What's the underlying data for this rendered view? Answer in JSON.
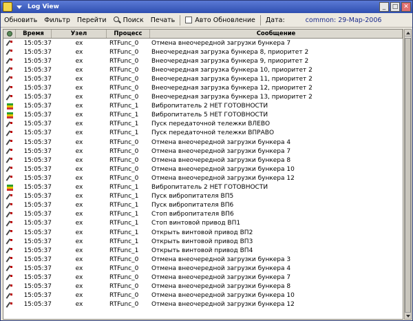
{
  "window": {
    "title": "Log View"
  },
  "toolbar": {
    "refresh": "Обновить",
    "filter": "Фильтр",
    "goto": "Перейти",
    "search": "Поиск",
    "print": "Печать",
    "auto_refresh": "Авто Обновление",
    "date_label": "Дата:",
    "date_value": "common: 29-Мар-2006"
  },
  "columns": {
    "time": "Время",
    "node": "Узел",
    "process": "Процесс",
    "message": "Сообщение"
  },
  "rows": [
    {
      "icon": "pen-icon",
      "time": "15:05:37",
      "node": "ex",
      "process": "RTFunc_0",
      "message": "Отмена внеочередной загрузки бункера 7"
    },
    {
      "icon": "pen-icon",
      "time": "15:05:37",
      "node": "ex",
      "process": "RTFunc_0",
      "message": "Внеочередная загрузка бункера 8, приоритет 2"
    },
    {
      "icon": "pen-icon",
      "time": "15:05:37",
      "node": "ex",
      "process": "RTFunc_0",
      "message": "Внеочередная загрузка бункера 9, приоритет 2"
    },
    {
      "icon": "pen-icon",
      "time": "15:05:37",
      "node": "ex",
      "process": "RTFunc_0",
      "message": "Внеочередная загрузка бункера 10, приоритет 2"
    },
    {
      "icon": "pen-icon",
      "time": "15:05:37",
      "node": "ex",
      "process": "RTFunc_0",
      "message": "Внеочередная загрузка бункера 11, приоритет 2"
    },
    {
      "icon": "pen-icon",
      "time": "15:05:37",
      "node": "ex",
      "process": "RTFunc_0",
      "message": "Внеочередная загрузка бункера 12, приоритет 2"
    },
    {
      "icon": "pen-icon",
      "time": "15:05:37",
      "node": "ex",
      "process": "RTFunc_0",
      "message": "Внеочередная загрузка бункера 13, приоритет 2"
    },
    {
      "icon": "vib-icon",
      "time": "15:05:37",
      "node": "ex",
      "process": "RTFunc_1",
      "message": "Вибропитатель 2 НЕТ ГОТОВНОСТИ"
    },
    {
      "icon": "vib-icon",
      "time": "15:05:37",
      "node": "ex",
      "process": "RTFunc_1",
      "message": "Вибропитатель 5 НЕТ ГОТОВНОСТИ"
    },
    {
      "icon": "pen-icon",
      "time": "15:05:37",
      "node": "ex",
      "process": "RTFunc_1",
      "message": "Пуск передаточной тележки ВЛЕВО"
    },
    {
      "icon": "pen-icon",
      "time": "15:05:37",
      "node": "ex",
      "process": "RTFunc_1",
      "message": "Пуск передаточной тележки ВПРАВО"
    },
    {
      "icon": "pen-icon",
      "time": "15:05:37",
      "node": "ex",
      "process": "RTFunc_0",
      "message": "Отмена внеочередной загрузки бункера 4"
    },
    {
      "icon": "pen-icon",
      "time": "15:05:37",
      "node": "ex",
      "process": "RTFunc_0",
      "message": "Отмена внеочередной загрузки бункера 7"
    },
    {
      "icon": "pen-icon",
      "time": "15:05:37",
      "node": "ex",
      "process": "RTFunc_0",
      "message": "Отмена внеочередной загрузки бункера 8"
    },
    {
      "icon": "pen-icon",
      "time": "15:05:37",
      "node": "ex",
      "process": "RTFunc_0",
      "message": "Отмена внеочередной загрузки бункера 10"
    },
    {
      "icon": "pen-icon",
      "time": "15:05:37",
      "node": "ex",
      "process": "RTFunc_0",
      "message": "Отмена внеочередной загрузки бункера 12"
    },
    {
      "icon": "vib-icon",
      "time": "15:05:37",
      "node": "ex",
      "process": "RTFunc_1",
      "message": "Вибропитатель 2 НЕТ ГОТОВНОСТИ"
    },
    {
      "icon": "pen-icon",
      "time": "15:05:37",
      "node": "ex",
      "process": "RTFunc_1",
      "message": "Пуск вибропитателя ВП5"
    },
    {
      "icon": "pen-icon",
      "time": "15:05:37",
      "node": "ex",
      "process": "RTFunc_1",
      "message": "Пуск вибропитателя ВП6"
    },
    {
      "icon": "pen-icon",
      "time": "15:05:37",
      "node": "ex",
      "process": "RTFunc_1",
      "message": "Стоп вибропитателя ВП6"
    },
    {
      "icon": "pen-icon",
      "time": "15:05:37",
      "node": "ex",
      "process": "RTFunc_1",
      "message": "Стоп винтовой привод ВП1"
    },
    {
      "icon": "pen-icon",
      "time": "15:05:37",
      "node": "ex",
      "process": "RTFunc_1",
      "message": "Открыть винтовой привод ВП2"
    },
    {
      "icon": "pen-icon",
      "time": "15:05:37",
      "node": "ex",
      "process": "RTFunc_1",
      "message": "Открыть винтовой привод ВП3"
    },
    {
      "icon": "pen-icon",
      "time": "15:05:37",
      "node": "ex",
      "process": "RTFunc_1",
      "message": "Открыть винтовой привод ВП4"
    },
    {
      "icon": "pen-icon",
      "time": "15:05:37",
      "node": "ex",
      "process": "RTFunc_0",
      "message": "Отмена внеочередной загрузки бункера 3"
    },
    {
      "icon": "pen-icon",
      "time": "15:05:37",
      "node": "ex",
      "process": "RTFunc_0",
      "message": "Отмена внеочередной загрузки бункера 4"
    },
    {
      "icon": "pen-icon",
      "time": "15:05:37",
      "node": "ex",
      "process": "RTFunc_0",
      "message": "Отмена внеочередной загрузки бункера 7"
    },
    {
      "icon": "pen-icon",
      "time": "15:05:37",
      "node": "ex",
      "process": "RTFunc_0",
      "message": "Отмена внеочередной загрузки бункера 8"
    },
    {
      "icon": "pen-icon",
      "time": "15:05:37",
      "node": "ex",
      "process": "RTFunc_0",
      "message": "Отмена внеочередной загрузки бункера 10"
    },
    {
      "icon": "pen-icon",
      "time": "15:05:37",
      "node": "ex",
      "process": "RTFunc_0",
      "message": "Отмена внеочередной загрузки бункера 12"
    }
  ]
}
